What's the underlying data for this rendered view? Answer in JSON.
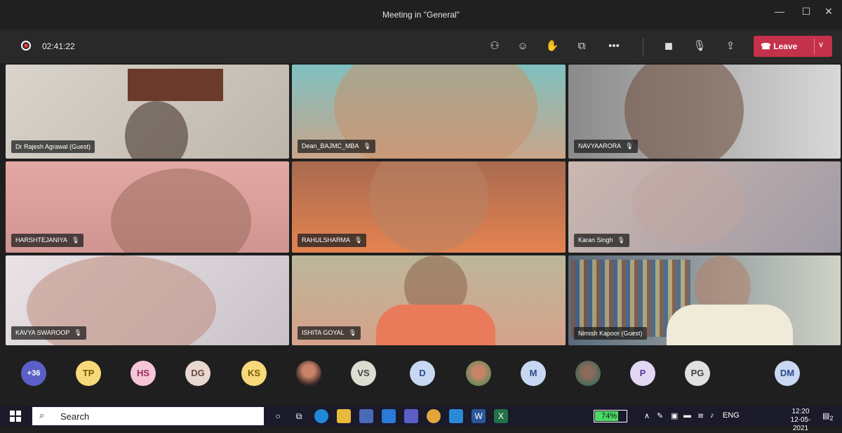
{
  "window": {
    "title": "Meeting in \"General\""
  },
  "meeting": {
    "timer": "02:41:22",
    "leave_label": "Leave",
    "colors": {
      "leave": "#c4314b",
      "record": "#e3383c"
    }
  },
  "participants": [
    {
      "name": "Dr Rajesh Agrawal (Guest)",
      "muted": false
    },
    {
      "name": "Dean_BAJMC_MBA",
      "muted": true
    },
    {
      "name": "NAVYAARORA",
      "muted": true
    },
    {
      "name": "HARSHTEJANIYA",
      "muted": true
    },
    {
      "name": "RAHULSHARMA",
      "muted": true
    },
    {
      "name": "Karan Singh",
      "muted": true
    },
    {
      "name": "KAVYA SWAROOP",
      "muted": true
    },
    {
      "name": "ISHITA GOYAL",
      "muted": true
    },
    {
      "name": "Nimish Kapoor (Guest)",
      "muted": false
    }
  ],
  "mute_glyph": "🎙",
  "avatars": [
    "+36",
    "TP",
    "HS",
    "DG",
    "KS",
    "",
    "VS",
    "D",
    "",
    "M",
    "",
    "P",
    "PG",
    "DM"
  ],
  "taskbar": {
    "search_label": "Search",
    "battery": "74%",
    "battery_level": 0.74,
    "lang": "ENG",
    "time": "12:20",
    "date": "12-05-2021",
    "notification_count": "2"
  }
}
